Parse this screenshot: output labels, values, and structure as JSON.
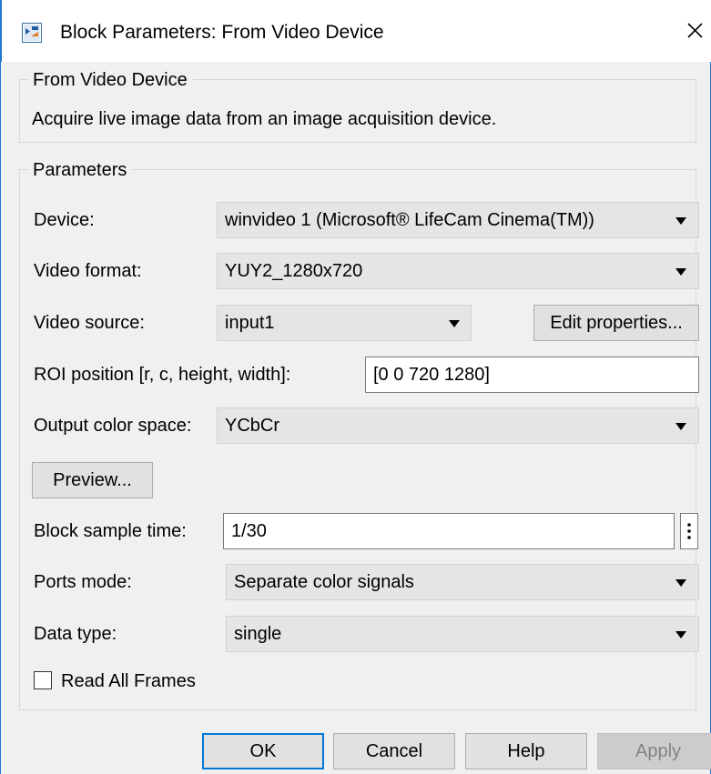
{
  "window": {
    "title": "Block Parameters: From Video Device",
    "app_icon": "simulink-block-icon",
    "close_icon": "close-icon"
  },
  "description_group": {
    "legend": "From Video Device",
    "text": "Acquire live image data from an image acquisition device."
  },
  "parameters": {
    "legend": "Parameters",
    "device": {
      "label": "Device:",
      "value": "winvideo 1 (Microsoft® LifeCam Cinema(TM))"
    },
    "video_format": {
      "label": "Video format:",
      "value": "YUY2_1280x720"
    },
    "video_source": {
      "label": "Video source:",
      "value": "input1"
    },
    "edit_properties_label": "Edit properties...",
    "roi": {
      "label": "ROI position [r, c, height, width]:",
      "value": "[0 0 720 1280]"
    },
    "output_color_space": {
      "label": "Output color space:",
      "value": "YCbCr"
    },
    "preview_label": "Preview...",
    "block_sample_time": {
      "label": "Block sample time:",
      "value": "1/30"
    },
    "ports_mode": {
      "label": "Ports mode:",
      "value": "Separate color signals"
    },
    "data_type": {
      "label": "Data type:",
      "value": "single"
    },
    "read_all_frames": {
      "label": "Read All Frames",
      "checked": false
    }
  },
  "buttons": {
    "ok": "OK",
    "cancel": "Cancel",
    "help": "Help",
    "apply": "Apply"
  },
  "colors": {
    "accent": "#0078d7",
    "window_border": "#1e78d2",
    "dialog_bg": "#f0f0f0",
    "disabled_text": "#838383"
  }
}
